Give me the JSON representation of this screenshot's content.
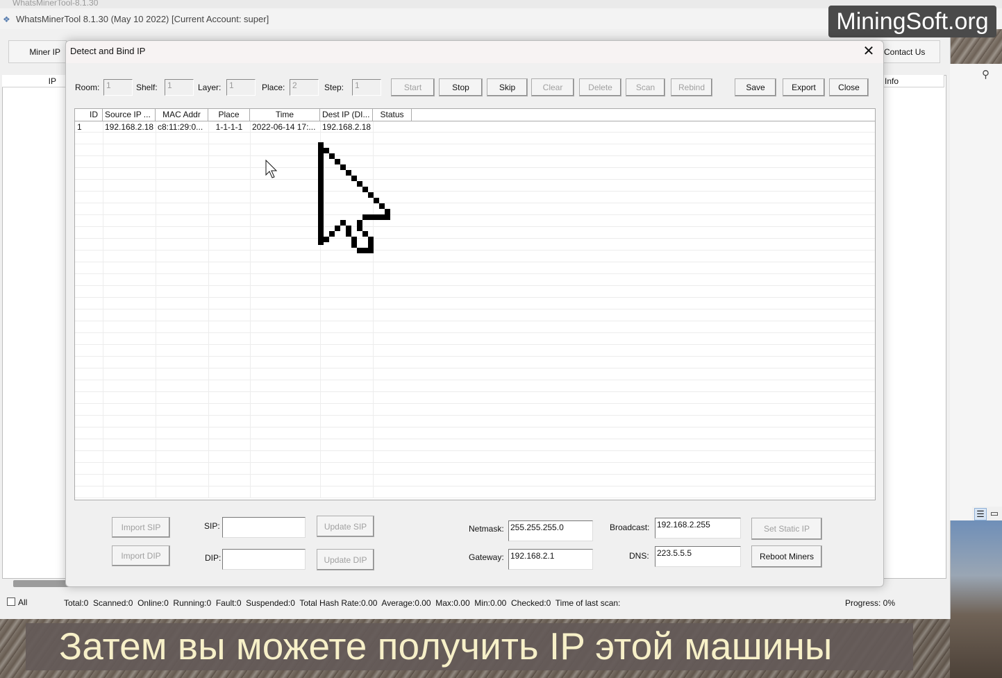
{
  "app": {
    "old_title": "WhatsMinerTool-8.1.30",
    "title": "WhatsMinerTool 8.1.30 (May 10 2022) [Current Account: super]",
    "miner_ip_label": "Miner IP",
    "contact_label": "Contact Us",
    "col_ip": "IP",
    "col_info": "Info"
  },
  "watermark": "MiningSoft.org",
  "dialog": {
    "title": "Detect and Bind IP",
    "room_label": "Room:",
    "room_value": "1",
    "shelf_label": "Shelf:",
    "shelf_value": "1",
    "layer_label": "Layer:",
    "layer_value": "1",
    "place_label": "Place:",
    "place_value": "2",
    "step_label": "Step:",
    "step_value": "1",
    "buttons": {
      "start": "Start",
      "stop": "Stop",
      "skip": "Skip",
      "clear": "Clear",
      "delete": "Delete",
      "scan": "Scan",
      "rebind": "Rebind",
      "save": "Save",
      "export": "Export",
      "close": "Close"
    },
    "columns": [
      "ID",
      "Source IP ...",
      "MAC Addr",
      "Place",
      "Time",
      "Dest IP (DI...",
      "Status"
    ],
    "rows": [
      {
        "id": "1",
        "source_ip": "192.168.2.18",
        "mac": "c8:11:29:0...",
        "place": "1-1-1-1",
        "time": "2022-06-14 17:...",
        "dest_ip": "192.168.2.18",
        "status": ""
      }
    ],
    "bottom": {
      "import_sip": "Import SIP",
      "import_dip": "Import DIP",
      "sip_label": "SIP:",
      "dip_label": "DIP:",
      "sip_value": "",
      "dip_value": "",
      "update_sip": "Update SIP",
      "update_dip": "Update DIP",
      "netmask_label": "Netmask:",
      "netmask_value": "255.255.255.0",
      "gateway_label": "Gateway:",
      "gateway_value": "192.168.2.1",
      "broadcast_label": "Broadcast:",
      "broadcast_value": "192.168.2.255",
      "dns_label": "DNS:",
      "dns_value": "223.5.5.5",
      "set_static_ip": "Set Static IP",
      "reboot_miners": "Reboot Miners"
    }
  },
  "status_bar": {
    "all_label": "All",
    "stats": "Total:0  Scanned:0  Online:0  Running:0  Fault:0  Suspended:0  Total Hash Rate:0.00  Average:0.00  Max:0.00  Min:0.00  Checked:0  Time of last scan:",
    "progress": "Progress: 0%"
  },
  "subtitle": "Затем вы можете получить IP этой машины"
}
